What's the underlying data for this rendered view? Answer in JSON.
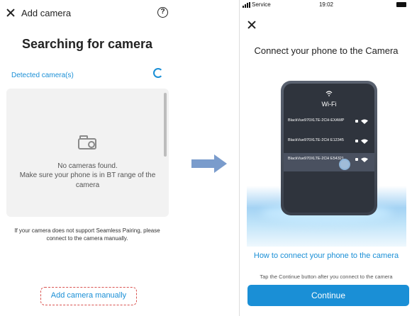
{
  "left_screen": {
    "header": {
      "title": "Add camera",
      "close_icon": "close-icon",
      "help_icon": "help-icon",
      "help_glyph": "?"
    },
    "heading": "Searching for camera",
    "detected_label": "Detected camera(s)",
    "empty_state": {
      "icon": "camera-icon",
      "message": "No cameras found.",
      "hint": "Make sure your phone is in BT range of the camera"
    },
    "note": "If your camera does not support Seamless Pairing, please connect to the camera manually.",
    "manual_button_label": "Add camera manually"
  },
  "right_screen": {
    "statusbar": {
      "carrier": "Service",
      "time": "19:02"
    },
    "heading": "Connect your phone to the Camera",
    "illustration": {
      "wifi_label": "Wi-Fi",
      "networks": [
        {
          "name": "BlackVue970XLTE-2CH-EXAMP",
          "selected": false
        },
        {
          "name": "BlackVue970XLTE-2CH E12345",
          "selected": false
        },
        {
          "name": "BlackVue970XLTE-2CH E54321",
          "selected": true
        }
      ]
    },
    "help_link": "How to connect your phone to the camera",
    "tip": "Tap the Continue button after you connect to the camera",
    "continue_label": "Continue"
  },
  "colors": {
    "accent": "#1a8fd6",
    "highlight_border": "#d9534f",
    "arrow": "#7a9ccc"
  }
}
